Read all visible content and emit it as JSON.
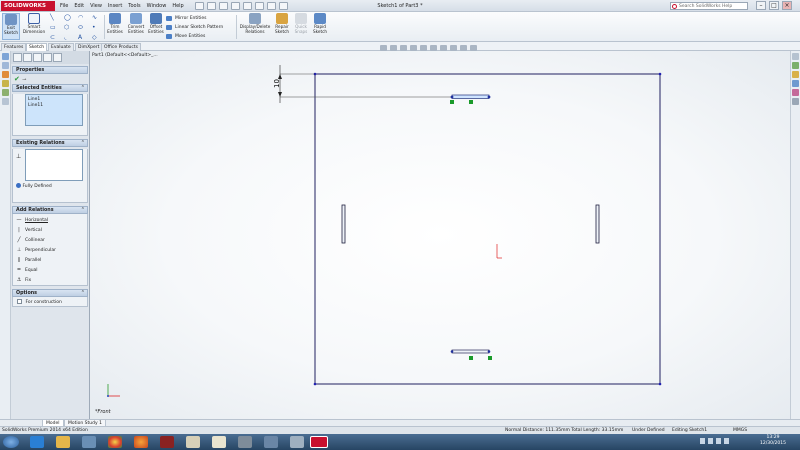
{
  "app": {
    "logo": "SOLIDWORKS",
    "doc_title": "Sketch1 of Part3 *",
    "menus": [
      "File",
      "Edit",
      "View",
      "Insert",
      "Tools",
      "Window",
      "Help"
    ],
    "search_placeholder": "Search SolidWorks Help"
  },
  "ribbon": {
    "exit_sketch": "Exit\nSketch",
    "smart_dimension": "Smart\nDimension",
    "trim_entities": "Trim\nEntities",
    "convert_entities": "Convert\nEntities",
    "offset_entities": "Offset\nEntities",
    "mirror_entities": "Mirror Entities",
    "linear_pattern": "Linear Sketch Pattern",
    "move_entities": "Move Entities",
    "display_delete": "Display/Delete\nRelations",
    "repair_sketch": "Repair\nSketch",
    "quick_snaps": "Quick\nSnaps",
    "rapid_sketch": "Rapid\nSketch"
  },
  "tabs": [
    "Features",
    "Sketch",
    "Evaluate",
    "DimXpert",
    "Office Products"
  ],
  "active_tab": "Sketch",
  "panel": {
    "title": "Properties",
    "selected_entities": {
      "title": "Selected Entities",
      "items": [
        "Line1",
        "Line11"
      ]
    },
    "existing_relations": {
      "title": "Existing Relations",
      "status": "Fully Defined"
    },
    "add_relations": {
      "title": "Add Relations",
      "items": [
        "Horizontal",
        "Vertical",
        "Collinear",
        "Perpendicular",
        "Parallel",
        "Equal",
        "Fix"
      ]
    },
    "options": {
      "title": "Options",
      "for_construction": "For construction"
    }
  },
  "canvas": {
    "breadcrumb": "Part1 (Default<<Default>_...",
    "dimension": "10",
    "view_label": "*Front"
  },
  "bottom_tabs": [
    "Model",
    "Motion Study 1"
  ],
  "status": {
    "edition": "SolidWorks Premium 2014 x64 Edition",
    "measurement": "Normal Distance: 111.35mm  Total Length: 33.15mm",
    "defined": "Under Defined",
    "editing": "Editing Sketch1",
    "units": "MMGS"
  },
  "taskbar": {
    "time": "13:29",
    "date": "12/30/2015"
  }
}
